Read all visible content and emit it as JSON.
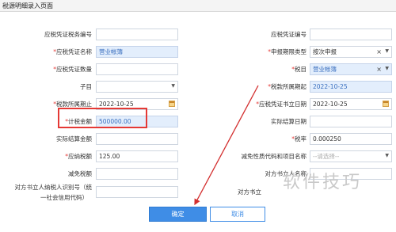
{
  "window": {
    "title": "税源明细录入页面"
  },
  "left": {
    "voucher_no": {
      "label": "应税凭证税务编号",
      "value": ""
    },
    "voucher_name": {
      "label": "应税凭证名称",
      "value": "营业帐簿"
    },
    "voucher_qty": {
      "label": "应税凭证数量",
      "value": ""
    },
    "sub_item": {
      "label": "子目",
      "value": ""
    },
    "period_end": {
      "label": "税款所属期止",
      "value": "2022-10-25"
    },
    "tax_amount": {
      "label": "计税金额",
      "value": "500000.00"
    },
    "actual_settle_amount": {
      "label": "实际结算金额",
      "value": ""
    },
    "tax_payable": {
      "label": "应纳税额",
      "value": "125.00"
    },
    "tax_relief": {
      "label": "减免税额",
      "value": ""
    },
    "counterparty_id": {
      "label_line1": "对方书立人纳税人识别号（统",
      "label_line2": "一社会信用代码）",
      "value": ""
    }
  },
  "right": {
    "voucher_code": {
      "label": "应税凭证编号",
      "value": ""
    },
    "report_period_type": {
      "label": "申报期限类型",
      "value": "按次申报"
    },
    "tax_item": {
      "label": "税目",
      "value": "营业帐簿"
    },
    "period_start": {
      "label": "税款所属期起",
      "value": "2022-10-25"
    },
    "voucher_date": {
      "label": "应税凭证书立日期",
      "value": "2022-10-25"
    },
    "actual_settle_date": {
      "label": "实际结算日期",
      "value": ""
    },
    "tax_rate": {
      "label": "税率",
      "value": "0.000250"
    },
    "relief_code": {
      "label": "减免性质代码和项目名称",
      "placeholder": "--请选择--"
    },
    "counterparty_name": {
      "label": "对方书立人名称",
      "value": ""
    },
    "counterparty": {
      "label": "对方书立",
      "value": ""
    }
  },
  "buttons": {
    "confirm": "确定",
    "cancel": "取消"
  },
  "watermark": "软件技巧",
  "colors": {
    "primary": "#3f8de6",
    "required": "#e53935",
    "highlight": "#e53935",
    "readonly_bg": "#e3eefc"
  },
  "icons": {
    "calendar": "calendar-icon",
    "dropdown": "chevron-down-icon",
    "clear": "close-icon"
  }
}
